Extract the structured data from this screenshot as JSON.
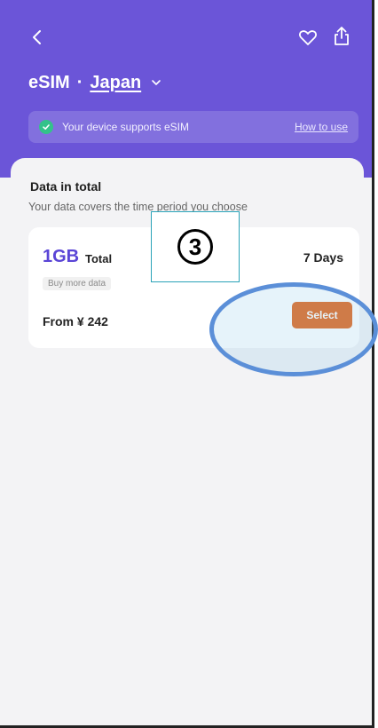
{
  "header": {
    "title": "eSIM",
    "separator": "·",
    "country": "Japan",
    "back_icon": "chevron-left-icon",
    "favorite_icon": "heart-icon",
    "share_icon": "share-icon"
  },
  "support": {
    "text": "Your device supports eSIM",
    "link": "How to use"
  },
  "section": {
    "title": "Data in total",
    "subtitle": "Your data covers the time period you choose"
  },
  "plan": {
    "data_amount": "1GB",
    "data_suffix": "Total",
    "duration": "7 Days",
    "buy_more": "Buy more data",
    "price": "From ¥ 242",
    "select_label": "Select"
  },
  "annotation": {
    "step_number": "3"
  },
  "colors": {
    "header_bg": "#6b55d8",
    "accent_text": "#5a45d6",
    "select_button": "#e2661c",
    "check_green": "#33c28a",
    "annotation_ellipse": "#5b8fd8"
  }
}
